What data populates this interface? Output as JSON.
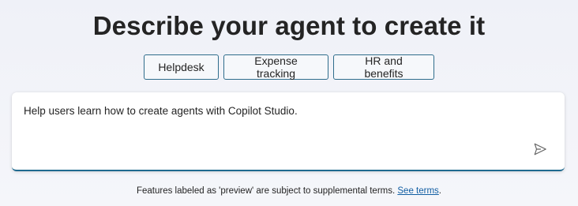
{
  "headline": "Describe your agent to create it",
  "chips": [
    {
      "label": "Helpdesk"
    },
    {
      "label": "Expense tracking"
    },
    {
      "label": "HR and benefits"
    }
  ],
  "prompt": {
    "value": "Help users learn how to create agents with Copilot Studio.",
    "send_icon": "send-icon"
  },
  "footer": {
    "text": "Features labeled as 'preview' are subject to supplemental terms. ",
    "link": "See terms",
    "suffix": "."
  },
  "colors": {
    "accent": "#1f6a8f",
    "link": "#115ea3",
    "text": "#242424"
  }
}
